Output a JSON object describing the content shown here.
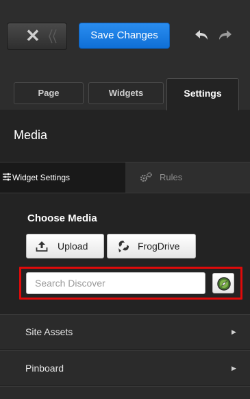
{
  "toolbar": {
    "close_icon": "close-icon",
    "save_label": "Save Changes",
    "undo_icon": "undo-icon",
    "redo_icon": "redo-icon"
  },
  "tabs": [
    {
      "label": "Page",
      "active": false
    },
    {
      "label": "Widgets",
      "active": false
    },
    {
      "label": "Settings",
      "active": true
    }
  ],
  "panel": {
    "title": "Media",
    "subtabs": [
      {
        "label": "Widget Settings",
        "icon": "sliders-icon",
        "active": true
      },
      {
        "label": "Rules",
        "icon": "cogs-icon",
        "active": false
      }
    ]
  },
  "choose_media": {
    "title": "Choose Media",
    "upload_label": "Upload",
    "frogdrive_label": "FrogDrive",
    "search_placeholder": "Search Discover",
    "search_value": ""
  },
  "accordion": [
    {
      "label": "Site Assets"
    },
    {
      "label": "Pinboard"
    }
  ],
  "colors": {
    "accent": "#1a7fe8",
    "highlight": "#e00a0a",
    "panel_bg": "#232323"
  }
}
